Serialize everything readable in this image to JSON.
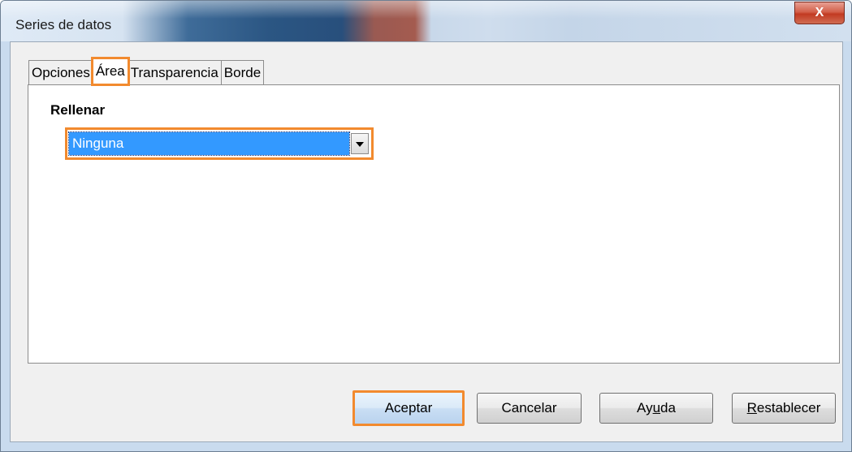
{
  "window": {
    "title": "Series de datos",
    "close_label": "X"
  },
  "tabs": [
    {
      "label": "Opciones",
      "active": false
    },
    {
      "label": "Área",
      "active": true
    },
    {
      "label": "Transparencia",
      "active": false
    },
    {
      "label": "Borde",
      "active": false
    }
  ],
  "area": {
    "fill_label": "Rellenar",
    "fill_value": "Ninguna"
  },
  "buttons": {
    "ok": "Aceptar",
    "cancel": "Cancelar",
    "help_pre": "Ay",
    "help_mnemonic": "u",
    "help_post": "da",
    "reset_mnemonic": "R",
    "reset_post": "establecer"
  },
  "colors": {
    "highlight": "#f28a2e",
    "selection": "#3399ff"
  }
}
